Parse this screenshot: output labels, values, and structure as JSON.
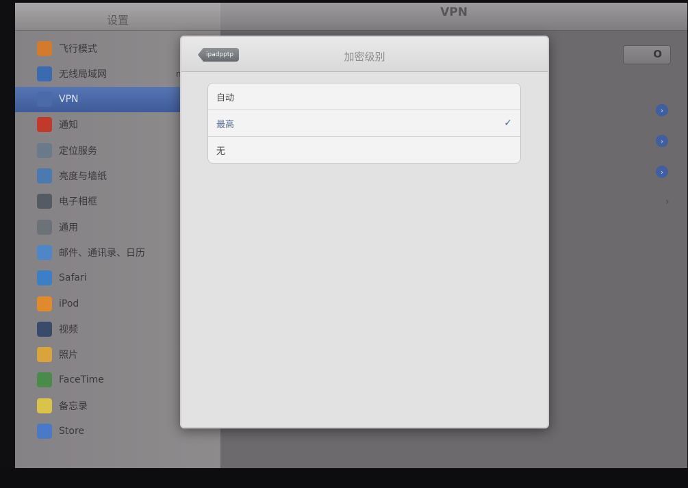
{
  "sidebar": {
    "title": "设置",
    "items": [
      {
        "label": "飞行模式",
        "icon": "airplane-icon",
        "color": "#d27a2e"
      },
      {
        "label": "无线局域网",
        "icon": "wifi-icon",
        "color": "#3a6ab0",
        "value": "ni"
      },
      {
        "label": "VPN",
        "icon": "vpn-icon",
        "color": "#4a6aa8",
        "selected": true
      },
      {
        "label": "通知",
        "icon": "notifications-icon",
        "color": "#c0392b"
      },
      {
        "label": "定位服务",
        "icon": "location-icon",
        "color": "#6a7a8a"
      },
      {
        "label": "亮度与墙纸",
        "icon": "brightness-icon",
        "color": "#4a7ab0"
      },
      {
        "label": "电子相框",
        "icon": "picture-frame-icon",
        "color": "#555b63"
      },
      {
        "label": "通用",
        "icon": "gear-icon",
        "color": "#6d7278"
      },
      {
        "label": "邮件、通讯录、日历",
        "icon": "mail-icon",
        "color": "#4f86c6"
      },
      {
        "label": "Safari",
        "icon": "safari-icon",
        "color": "#3d7fc4"
      },
      {
        "label": "iPod",
        "icon": "ipod-icon",
        "color": "#e08a2c"
      },
      {
        "label": "视频",
        "icon": "video-icon",
        "color": "#3a4a6a"
      },
      {
        "label": "照片",
        "icon": "photos-icon",
        "color": "#d9a53a"
      },
      {
        "label": "FaceTime",
        "icon": "facetime-icon",
        "color": "#4a8a4a"
      },
      {
        "label": "备忘录",
        "icon": "notes-icon",
        "color": "#d9c34a"
      },
      {
        "label": "Store",
        "icon": "store-icon",
        "color": "#4a7ac6"
      }
    ]
  },
  "detail": {
    "title": "VPN",
    "toggle_label": "O"
  },
  "popover": {
    "back_label": "ipadpptp",
    "title": "加密级别",
    "options": [
      {
        "label": "自动",
        "selected": false
      },
      {
        "label": "最高",
        "selected": true
      },
      {
        "label": "无",
        "selected": false
      }
    ],
    "checkmark": "✓"
  }
}
